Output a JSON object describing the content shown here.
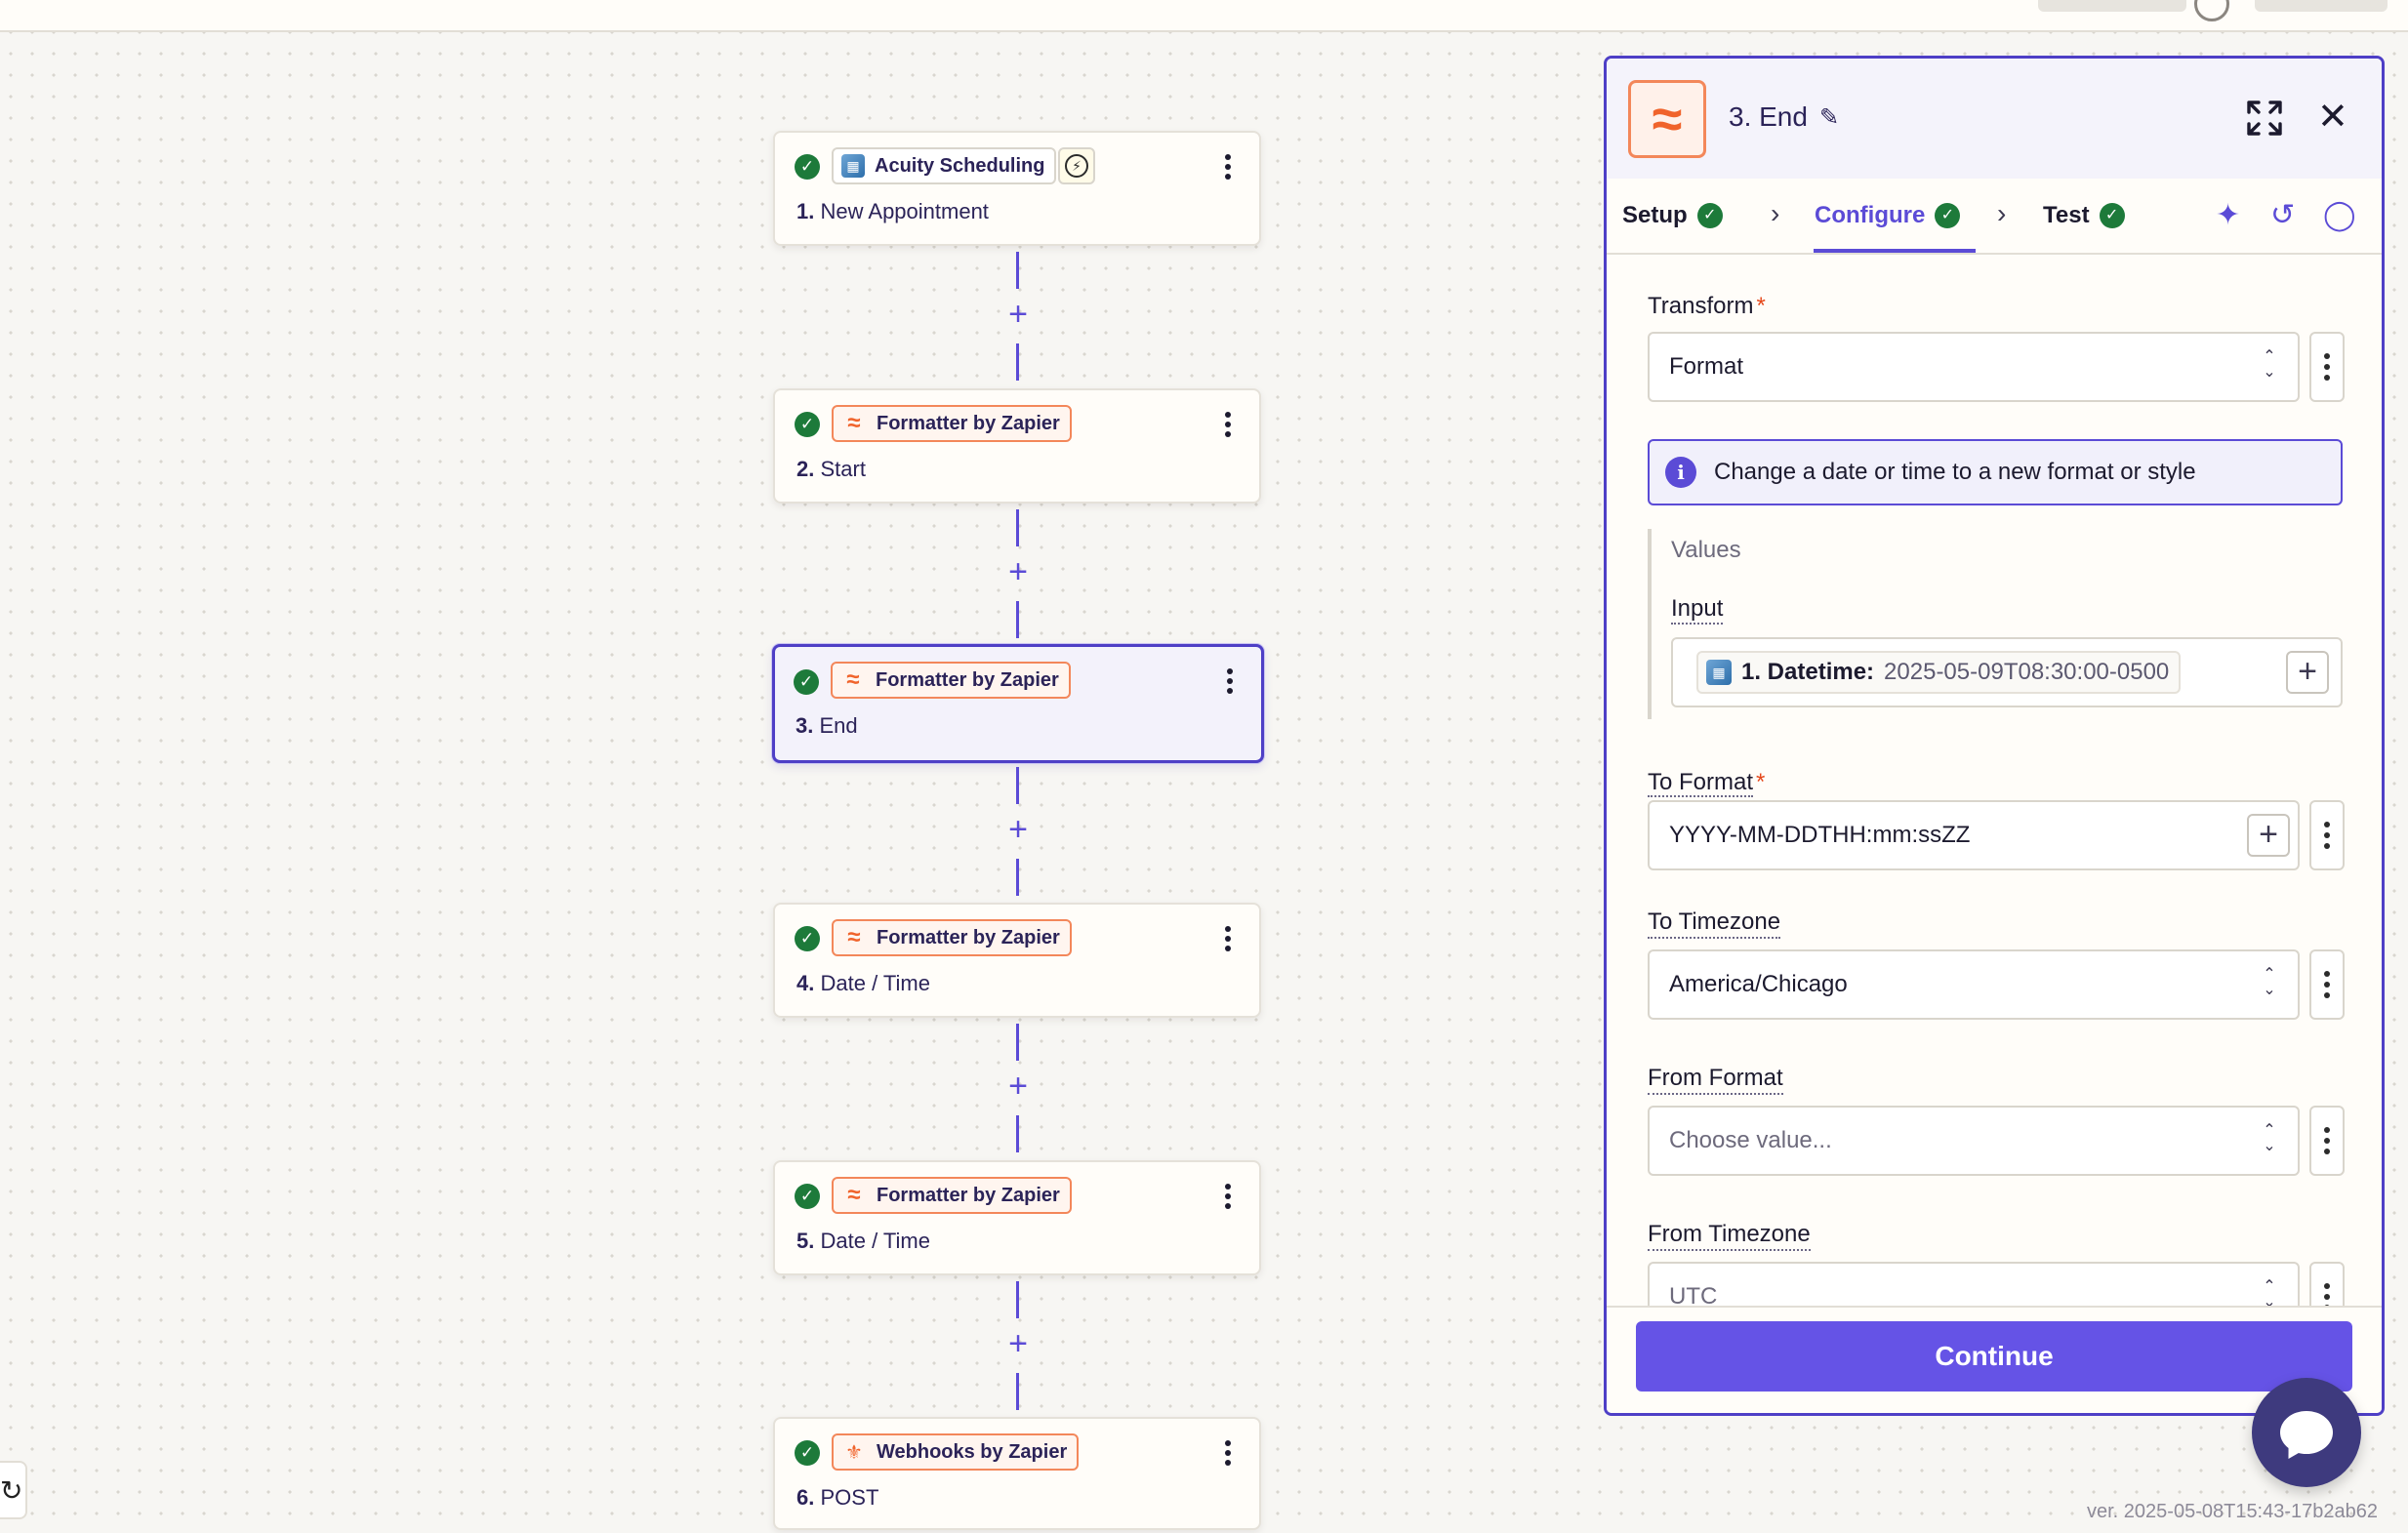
{
  "flow": {
    "steps": [
      {
        "app": "Acuity Scheduling",
        "number": "1.",
        "name": "New Appointment",
        "icon": "acuity-calendar-icon",
        "trigger": true
      },
      {
        "app": "Formatter by Zapier",
        "number": "2.",
        "name": "Start",
        "icon": "formatter-icon"
      },
      {
        "app": "Formatter by Zapier",
        "number": "3.",
        "name": "End",
        "icon": "formatter-icon",
        "selected": true
      },
      {
        "app": "Formatter by Zapier",
        "number": "4.",
        "name": "Date / Time",
        "icon": "formatter-icon"
      },
      {
        "app": "Formatter by Zapier",
        "number": "5.",
        "name": "Date / Time",
        "icon": "formatter-icon"
      },
      {
        "app": "Webhooks by Zapier",
        "number": "6.",
        "name": "POST",
        "icon": "webhook-icon"
      }
    ],
    "add_symbol": "+"
  },
  "panel": {
    "title": "3. End",
    "tabs": [
      {
        "label": "Setup",
        "status": "complete"
      },
      {
        "label": "Configure",
        "status": "complete",
        "active": true
      },
      {
        "label": "Test",
        "status": "complete"
      }
    ],
    "transform": {
      "label": "Transform",
      "required": "*",
      "value": "Format"
    },
    "info": "Change a date or time to a new format or style",
    "values_group": {
      "title": "Values",
      "input_label": "Input",
      "token_label": "1. Datetime:",
      "token_value": "2025-05-09T08:30:00-0500"
    },
    "to_format": {
      "label": "To Format",
      "required": "*",
      "value": "YYYY-MM-DDTHH:mm:ssZZ"
    },
    "to_timezone": {
      "label": "To Timezone",
      "value": "America/Chicago"
    },
    "from_format": {
      "label": "From Format",
      "placeholder": "Choose value..."
    },
    "from_timezone": {
      "label": "From Timezone",
      "value": "UTC"
    },
    "continue_label": "Continue"
  },
  "version": "ver. 2025-05-08T15:43-17b2ab62",
  "colors": {
    "accent": "#5b4bd6",
    "formatter": "#f0632b",
    "success": "#1d7a3a",
    "button": "#6553e6"
  }
}
